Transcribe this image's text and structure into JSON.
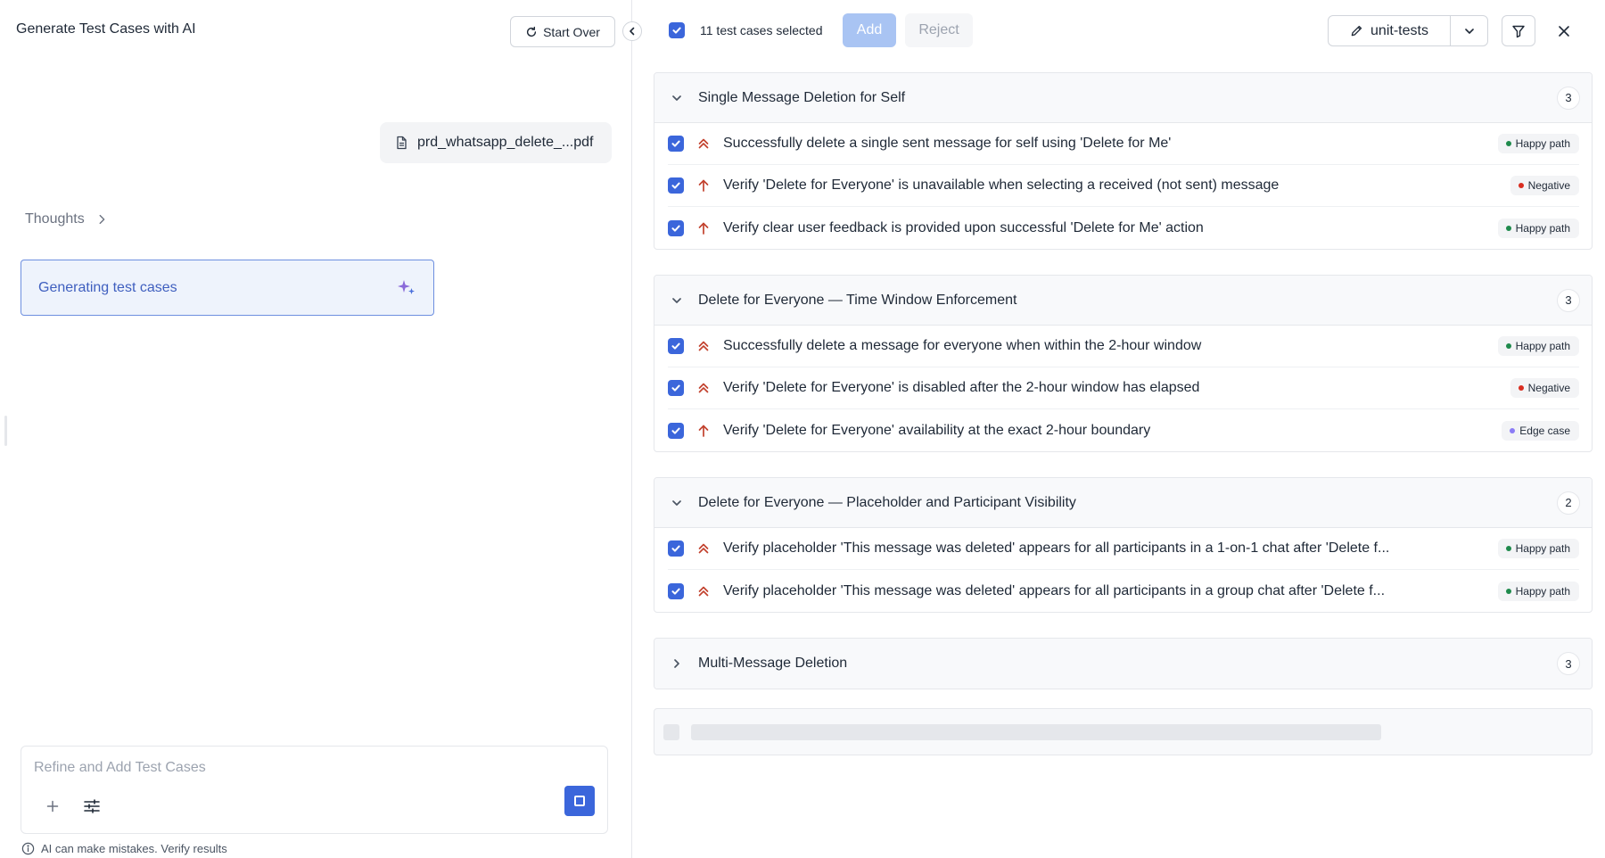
{
  "left": {
    "title": "Generate Test Cases with AI",
    "start_over_label": "Start Over",
    "file_name": "prd_whatsapp_delete_...pdf",
    "thoughts_label": "Thoughts",
    "status_label": "Generating test cases",
    "composer": {
      "placeholder": "Refine and Add Test Cases",
      "value": ""
    },
    "disclaimer": "AI can make mistakes. Verify results"
  },
  "toolbar": {
    "selected_text": "11 test cases selected",
    "add_label": "Add",
    "reject_label": "Reject",
    "suite_label": "unit-tests"
  },
  "colors": {
    "accent": "#3b66db",
    "priority": "#c2412d",
    "happy_path_dot": "#1f8a4c",
    "negative_dot": "#d92d20",
    "edge_case_dot": "#8b7cf6"
  },
  "groups": [
    {
      "title": "Single Message Deletion for Self",
      "count": "3",
      "expanded": true,
      "cases": [
        {
          "title": "Successfully delete a single sent message for self using 'Delete for Me'",
          "priority": "high-priority-icon",
          "tag": "Happy path"
        },
        {
          "title": "Verify 'Delete for Everyone' is unavailable when selecting a received (not sent) message",
          "priority": "medium-priority-icon",
          "tag": "Negative"
        },
        {
          "title": "Verify clear user feedback is provided upon successful 'Delete for Me' action",
          "priority": "medium-priority-icon",
          "tag": "Happy path"
        }
      ]
    },
    {
      "title": "Delete for Everyone — Time Window Enforcement",
      "count": "3",
      "expanded": true,
      "cases": [
        {
          "title": "Successfully delete a message for everyone when within the 2-hour window",
          "priority": "high-priority-icon",
          "tag": "Happy path"
        },
        {
          "title": "Verify 'Delete for Everyone' is disabled after the 2-hour window has elapsed",
          "priority": "high-priority-icon",
          "tag": "Negative"
        },
        {
          "title": "Verify 'Delete for Everyone' availability at the exact 2-hour boundary",
          "priority": "medium-priority-icon",
          "tag": "Edge case"
        }
      ]
    },
    {
      "title": "Delete for Everyone — Placeholder and Participant Visibility",
      "count": "2",
      "expanded": true,
      "cases": [
        {
          "title": "Verify placeholder 'This message was deleted' appears for all participants in a 1-on-1 chat after 'Delete f...",
          "priority": "high-priority-icon",
          "tag": "Happy path"
        },
        {
          "title": "Verify placeholder 'This message was deleted' appears for all participants in a group chat after 'Delete f...",
          "priority": "high-priority-icon",
          "tag": "Happy path"
        }
      ]
    },
    {
      "title": "Multi-Message Deletion",
      "count": "3",
      "expanded": false,
      "cases": []
    }
  ]
}
